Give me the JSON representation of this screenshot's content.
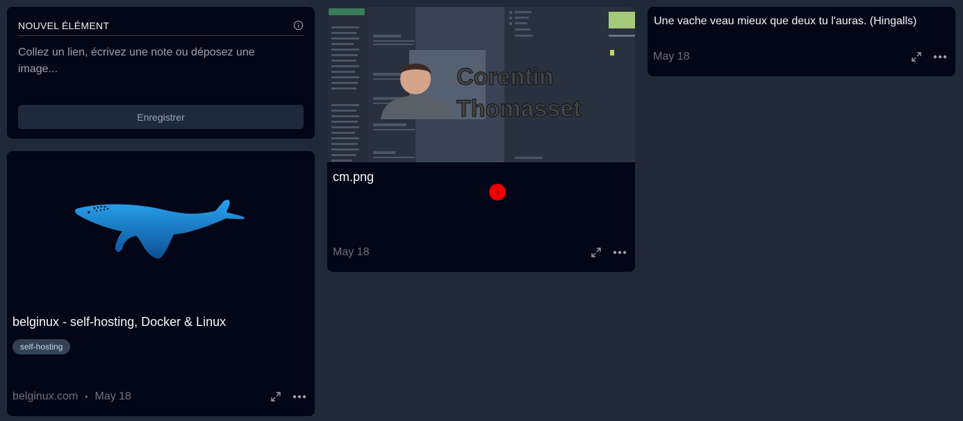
{
  "new_item": {
    "title": "NOUVEL ÉLÉMENT",
    "placeholder": "Collez un lien, écrivez une note ou déposez une image...",
    "save_label": "Enregistrer"
  },
  "link_card": {
    "title": "belginux - self-hosting, Docker & Linux",
    "tag": "self-hosting",
    "domain": "belginux.com",
    "separator": "•",
    "date": "May 18"
  },
  "image_card": {
    "title": "cm.png",
    "badge": "1",
    "date": "May 18",
    "overlay_text_line1": "Corentin",
    "overlay_text_line2": "Thomasset"
  },
  "note_card": {
    "text": "Une vache veau mieux que deux tu l'auras. (Hingalls)",
    "date": "May 18"
  },
  "icons": {
    "info": "info-icon",
    "expand": "expand-icon",
    "more": "more-icon",
    "whale": "whale-logo"
  },
  "colors": {
    "background": "#1f2937",
    "card": "#020617",
    "whale": "#1e88d6",
    "badge": "#ef0000"
  }
}
